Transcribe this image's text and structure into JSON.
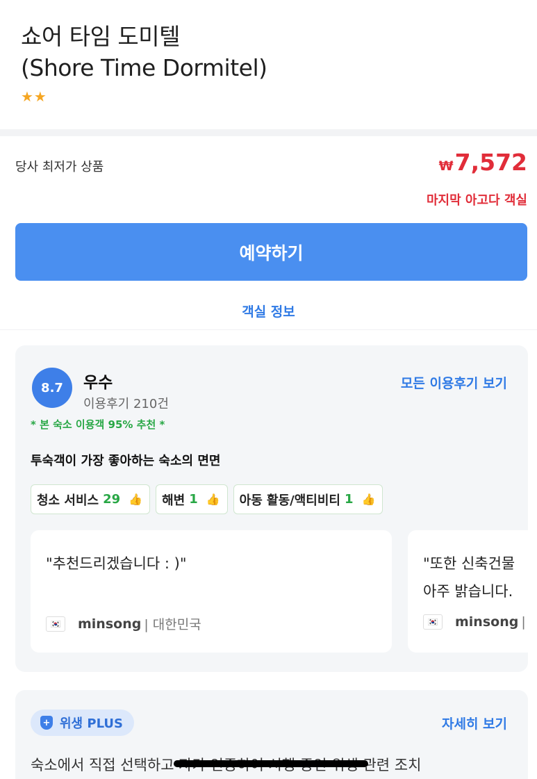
{
  "hotel": {
    "name_line1": "쇼어 타임 도미텔",
    "name_line2": "(Shore Time Dormitel)",
    "stars": "★★"
  },
  "offer": {
    "label": "당사 최저가 상품",
    "currency": "₩",
    "price": "7,572",
    "urgency": "마지막 아고다 객실",
    "book_button": "예약하기",
    "room_info_link": "객실 정보"
  },
  "reviews": {
    "score": "8.7",
    "rating_word": "우수",
    "count_text": "이용후기 210건",
    "all_link": "모든 이용후기 보기",
    "recommend": "* 본 숙소 이용객 95% 추천 *",
    "aspect_title": "투숙객이 가장 좋아하는 숙소의 면면",
    "tags": [
      {
        "label": "청소 서비스",
        "count": "29"
      },
      {
        "label": "해변",
        "count": "1"
      },
      {
        "label": "아동 활동/액티비티",
        "count": "1"
      }
    ],
    "items": [
      {
        "quote": "\"추천드리겠습니다 : )\"",
        "quote2": "",
        "name": "minsong",
        "country": "| 대한민국"
      },
      {
        "quote": "\"또한 신축건물",
        "quote2": "아주 밝습니다.",
        "name": "minsong",
        "country": "|"
      }
    ]
  },
  "hygiene": {
    "badge": "위생 PLUS",
    "more_link": "자세히 보기",
    "description": "숙소에서 직접 선택하고 자가 인증하여 시행 중인 위생 관련 조치"
  },
  "colors": {
    "accent_blue": "#4a8ff0",
    "price_red": "#e12d39",
    "recommend_green": "#28a745",
    "star_gold": "#f5a623"
  },
  "icons": {
    "thumb": "thumbs-up-icon",
    "flag": "korea-flag-icon",
    "shield": "shield-plus-icon"
  }
}
